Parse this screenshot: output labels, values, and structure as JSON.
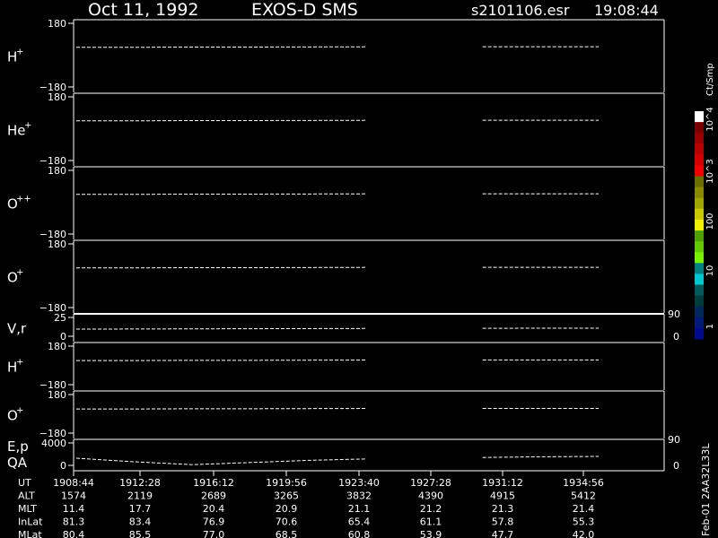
{
  "header": {
    "date": "Oct 11, 1992",
    "instrument": "EXOS-D SMS",
    "file": "s2101106.esr",
    "time": "19:08:44"
  },
  "footer_note": "Feb-01 2AA32L33L",
  "colorbar": {
    "unit": "Ct/Smp",
    "labels": [
      "10^4",
      "10^3",
      "100",
      "10",
      "1"
    ],
    "colors": [
      "#ffffff",
      "#7a0000",
      "#9a0000",
      "#b80000",
      "#d40000",
      "#f00000",
      "#6e6e00",
      "#8a8a00",
      "#a4a400",
      "#c8c800",
      "#f0f000",
      "#50a000",
      "#64c800",
      "#78f000",
      "#008080",
      "#00c8d0",
      "#005a5a",
      "#003c3c",
      "#00285a",
      "#001a78",
      "#000a8c"
    ]
  },
  "panels": [
    {
      "label": "H",
      "sup": "+",
      "ytop": "180",
      "ybot": "−180",
      "series": [
        0,
        0,
        0.1,
        0.1,
        0.15,
        0.2,
        null,
        0.2,
        0.2,
        0.2
      ]
    },
    {
      "label": "He",
      "sup": "+",
      "ytop": "180",
      "ybot": "−180",
      "series": [
        0,
        0,
        0.1,
        0.1,
        0.15,
        0.2,
        null,
        0.2,
        0.2,
        0.2
      ]
    },
    {
      "label": "O",
      "sup": "++",
      "ytop": "180",
      "ybot": "−180",
      "series": [
        0,
        0,
        0.1,
        0.1,
        0.15,
        0.2,
        null,
        0.2,
        0.2,
        0.2
      ]
    },
    {
      "label": "O",
      "sup": "+",
      "ytop": "180",
      "ybot": "−180",
      "series": [
        0,
        0,
        0.1,
        0.1,
        0.15,
        0.2,
        null,
        0.2,
        0.2,
        0.2
      ]
    },
    {
      "label": "V,r",
      "sup": "",
      "ytop": "25",
      "ybot": "0",
      "rtop": "90",
      "rbot": "0",
      "series": [
        0,
        0.05,
        0.1,
        0.15,
        0.2,
        0.25,
        null,
        0.3,
        0.35,
        0.35
      ]
    },
    {
      "label": "H",
      "sup": "+",
      "ytop": "180",
      "ybot": "−180",
      "series": [
        0,
        0,
        0.1,
        0.1,
        0.15,
        0.2,
        null,
        0.2,
        0.2,
        0.2
      ]
    },
    {
      "label": "O",
      "sup": "+",
      "ytop": "180",
      "ybot": "−180",
      "series": [
        0,
        0,
        0.1,
        0.1,
        0.15,
        0.2,
        null,
        0.2,
        0.2,
        0.2
      ]
    },
    {
      "label": "E,p",
      "label2": "QA",
      "sup": "",
      "ytop": "4000",
      "ybot": "0",
      "rtop": "90",
      "rbot": "0",
      "series": [
        0,
        -0.5,
        -0.9,
        -0.6,
        -0.3,
        -0.1,
        null,
        0.1,
        0.2,
        0.25
      ]
    }
  ],
  "ephemeris": {
    "rows": [
      {
        "name": "UT",
        "values": [
          "1908:44",
          "1912:28",
          "1916:12",
          "1919:56",
          "1923:40",
          "1927:28",
          "1931:12",
          "1934:56"
        ]
      },
      {
        "name": "ALT",
        "values": [
          "1574",
          "2119",
          "2689",
          "3265",
          "3832",
          "4390",
          "4915",
          "5412"
        ]
      },
      {
        "name": "MLT",
        "values": [
          "11.4",
          "17.7",
          "20.4",
          "20.9",
          "21.1",
          "21.2",
          "21.3",
          "21.4"
        ]
      },
      {
        "name": "InLat",
        "values": [
          "81.3",
          "83.4",
          "76.9",
          "70.6",
          "65.4",
          "61.1",
          "57.8",
          "55.3"
        ]
      },
      {
        "name": "MLat",
        "values": [
          "80.4",
          "85.5",
          "77.0",
          "68.5",
          "60.8",
          "53.9",
          "47.7",
          "42.0"
        ]
      }
    ]
  },
  "chart_data": {
    "type": "line",
    "title": "Oct 11, 1992   EXOS-D SMS",
    "x_ticks": [
      "1908:44",
      "1912:28",
      "1916:12",
      "1919:56",
      "1923:40",
      "1927:28",
      "1931:12",
      "1934:56"
    ],
    "series": [
      {
        "name": "H+",
        "ylim": [
          -180,
          180
        ]
      },
      {
        "name": "He+",
        "ylim": [
          -180,
          180
        ]
      },
      {
        "name": "O++",
        "ylim": [
          -180,
          180
        ]
      },
      {
        "name": "O+",
        "ylim": [
          -180,
          180
        ]
      },
      {
        "name": "V,r",
        "ylim": [
          0,
          25
        ]
      },
      {
        "name": "H+",
        "ylim": [
          -180,
          180
        ]
      },
      {
        "name": "O+",
        "ylim": [
          -180,
          180
        ]
      },
      {
        "name": "E,p",
        "ylim": [
          0,
          4000
        ]
      }
    ]
  }
}
